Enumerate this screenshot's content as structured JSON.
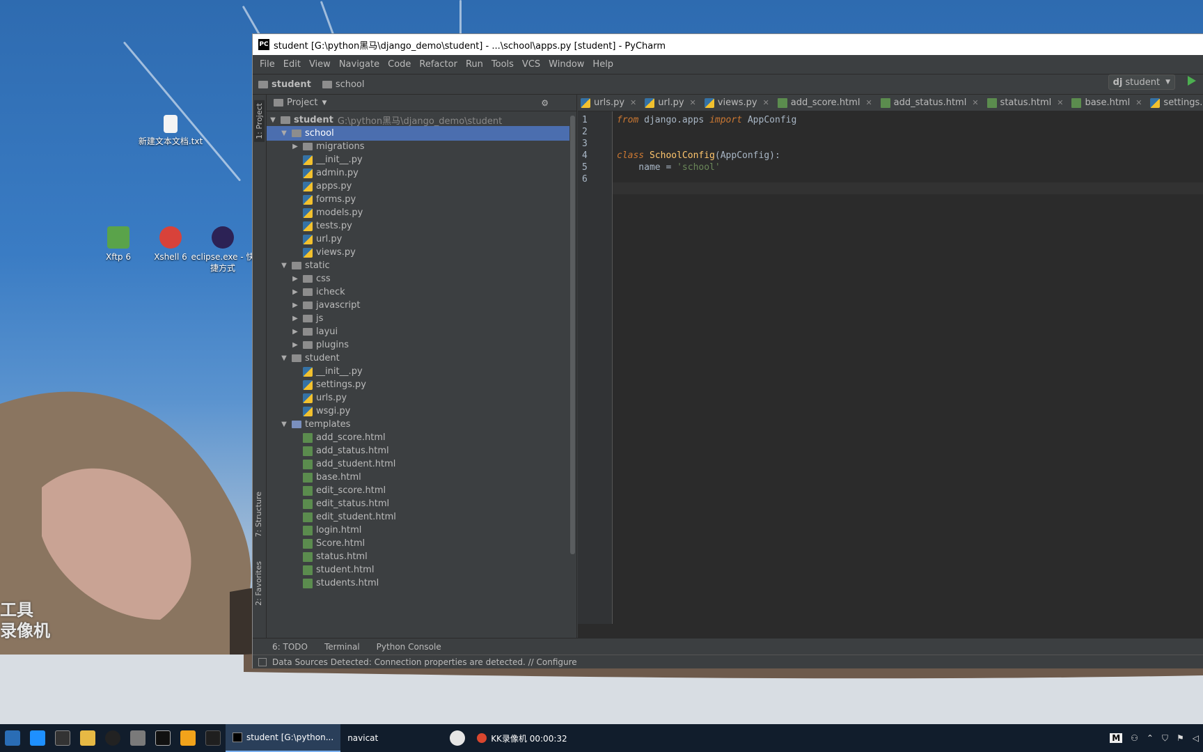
{
  "desktop": {
    "icons": [
      {
        "name": "text-file-icon",
        "label": "新建文本文档.txt"
      },
      {
        "name": "xftp-icon",
        "label": "Xftp 6"
      },
      {
        "name": "xshell-icon",
        "label": "Xshell 6"
      },
      {
        "name": "eclipse-icon",
        "label": "eclipse.exe - 快捷方式"
      }
    ],
    "watermark": [
      "工具",
      "录像机"
    ]
  },
  "window": {
    "title": "student [G:\\python黑马\\django_demo\\student] - ...\\school\\apps.py [student] - PyCharm",
    "menu": [
      "File",
      "Edit",
      "View",
      "Navigate",
      "Code",
      "Refactor",
      "Run",
      "Tools",
      "VCS",
      "Window",
      "Help"
    ],
    "breadcrumb": [
      "student",
      "school"
    ],
    "run_config": "student"
  },
  "sidebar": {
    "project_tab": "1: Project",
    "structure_tab": "7: Structure",
    "favorites_tab": "2: Favorites"
  },
  "project": {
    "header": "Project",
    "root_name": "student",
    "root_path": "G:\\python黑马\\django_demo\\student",
    "tree": [
      {
        "label": "school",
        "type": "folder",
        "depth": 1,
        "expanded": true,
        "selected": true
      },
      {
        "label": "migrations",
        "type": "folder",
        "depth": 2,
        "expanded": false
      },
      {
        "label": "__init__.py",
        "type": "py",
        "depth": 2
      },
      {
        "label": "admin.py",
        "type": "py",
        "depth": 2
      },
      {
        "label": "apps.py",
        "type": "py",
        "depth": 2
      },
      {
        "label": "forms.py",
        "type": "py",
        "depth": 2
      },
      {
        "label": "models.py",
        "type": "py",
        "depth": 2
      },
      {
        "label": "tests.py",
        "type": "py",
        "depth": 2
      },
      {
        "label": "url.py",
        "type": "py",
        "depth": 2
      },
      {
        "label": "views.py",
        "type": "py",
        "depth": 2
      },
      {
        "label": "static",
        "type": "folder",
        "depth": 1,
        "expanded": true
      },
      {
        "label": "css",
        "type": "folder",
        "depth": 2,
        "expanded": false
      },
      {
        "label": "icheck",
        "type": "folder",
        "depth": 2,
        "expanded": false
      },
      {
        "label": "javascript",
        "type": "folder",
        "depth": 2,
        "expanded": false
      },
      {
        "label": "js",
        "type": "folder",
        "depth": 2,
        "expanded": false
      },
      {
        "label": "layui",
        "type": "folder",
        "depth": 2,
        "expanded": false
      },
      {
        "label": "plugins",
        "type": "folder",
        "depth": 2,
        "expanded": false
      },
      {
        "label": "student",
        "type": "folder",
        "depth": 1,
        "expanded": true
      },
      {
        "label": "__init__.py",
        "type": "py",
        "depth": 2
      },
      {
        "label": "settings.py",
        "type": "py",
        "depth": 2
      },
      {
        "label": "urls.py",
        "type": "py",
        "depth": 2
      },
      {
        "label": "wsgi.py",
        "type": "py",
        "depth": 2
      },
      {
        "label": "templates",
        "type": "folder-blue",
        "depth": 1,
        "expanded": true
      },
      {
        "label": "add_score.html",
        "type": "html",
        "depth": 2
      },
      {
        "label": "add_status.html",
        "type": "html",
        "depth": 2
      },
      {
        "label": "add_student.html",
        "type": "html",
        "depth": 2
      },
      {
        "label": "base.html",
        "type": "html",
        "depth": 2
      },
      {
        "label": "edit_score.html",
        "type": "html",
        "depth": 2
      },
      {
        "label": "edit_status.html",
        "type": "html",
        "depth": 2
      },
      {
        "label": "edit_student.html",
        "type": "html",
        "depth": 2
      },
      {
        "label": "login.html",
        "type": "html",
        "depth": 2
      },
      {
        "label": "Score.html",
        "type": "html",
        "depth": 2
      },
      {
        "label": "status.html",
        "type": "html",
        "depth": 2
      },
      {
        "label": "student.html",
        "type": "html",
        "depth": 2
      },
      {
        "label": "students.html",
        "type": "html",
        "depth": 2
      }
    ]
  },
  "editor": {
    "tabs": [
      {
        "label": "urls.py",
        "type": "py"
      },
      {
        "label": "url.py",
        "type": "py"
      },
      {
        "label": "views.py",
        "type": "py"
      },
      {
        "label": "add_score.html",
        "type": "html"
      },
      {
        "label": "add_status.html",
        "type": "html"
      },
      {
        "label": "status.html",
        "type": "html"
      },
      {
        "label": "base.html",
        "type": "html"
      },
      {
        "label": "settings.py",
        "type": "py"
      }
    ],
    "line_numbers": [
      "1",
      "2",
      "3",
      "4",
      "5",
      "6"
    ],
    "code": {
      "l1_kw1": "from",
      "l1_mod": " django.apps ",
      "l1_kw2": "import",
      "l1_name": " AppConfig",
      "l4_kw": "class",
      "l4_cls": " SchoolConfig",
      "l4_rest": "(AppConfig):",
      "l5_name": "    name = ",
      "l5_str": "'school'"
    }
  },
  "bottom": {
    "todo": "6: TODO",
    "terminal": "Terminal",
    "console": "Python Console",
    "status": "Data Sources Detected: Connection properties are detected. // Configure"
  },
  "taskbar": {
    "apps": [
      "student [G:\\python...",
      "navicat",
      "KK录像机 00:00:32"
    ],
    "tray_label": "M"
  }
}
